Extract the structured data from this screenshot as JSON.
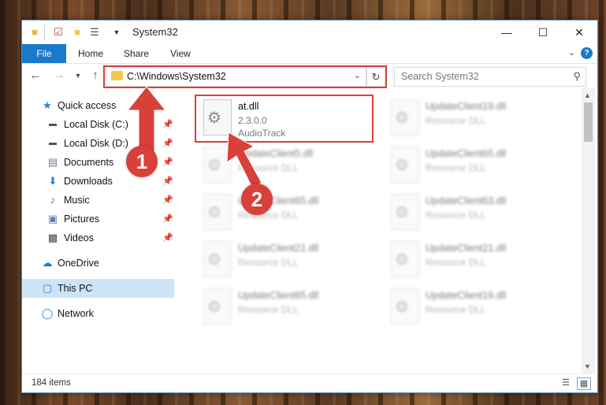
{
  "window": {
    "title": "System32",
    "minimize_glyph": "—",
    "maximize_glyph": "☐",
    "close_glyph": "✕"
  },
  "ribbon": {
    "file_label": "File",
    "tabs": [
      "Home",
      "Share",
      "View"
    ]
  },
  "address": {
    "path": "C:\\Windows\\System32"
  },
  "search": {
    "placeholder": "Search System32"
  },
  "sidebar": {
    "items": [
      {
        "label": "Quick access",
        "icon": "star-icon"
      },
      {
        "label": "Local Disk (C:)",
        "icon": "drive-icon"
      },
      {
        "label": "Local Disk (D:)",
        "icon": "drive-icon"
      },
      {
        "label": "Documents",
        "icon": "documents-icon"
      },
      {
        "label": "Downloads",
        "icon": "download-icon"
      },
      {
        "label": "Music",
        "icon": "music-icon"
      },
      {
        "label": "Pictures",
        "icon": "pictures-icon"
      },
      {
        "label": "Videos",
        "icon": "videos-icon"
      },
      {
        "label": "OneDrive",
        "icon": "cloud-icon"
      },
      {
        "label": "This PC",
        "icon": "computer-icon"
      },
      {
        "label": "Network",
        "icon": "network-icon"
      }
    ]
  },
  "files": {
    "highlighted": {
      "name": "at.dll",
      "version": "2.3.0.0",
      "description": "AudioTrack"
    },
    "others": [
      {
        "name": "UpdateClient19.dll",
        "type": "Resource DLL"
      },
      {
        "name": "UpdateClient5.dll",
        "type": "Resource DLL"
      },
      {
        "name": "UpdateClient65.dll",
        "type": "Resource DLL"
      },
      {
        "name": "UpdateClient65.dll",
        "type": "Resource DLL"
      },
      {
        "name": "UpdateClient63.dll",
        "type": "Resource DLL"
      },
      {
        "name": "UpdateClient21.dll",
        "type": "Resource DLL"
      },
      {
        "name": "UpdateClient21.dll",
        "type": "Resource DLL"
      },
      {
        "name": "UpdateClient65.dll",
        "type": "Resource DLL"
      },
      {
        "name": "UpdateClient19.dll",
        "type": "Resource DLL"
      }
    ]
  },
  "status": {
    "item_count": "184 items"
  },
  "annotations": {
    "step1": "1",
    "step2": "2",
    "color": "#d9403a"
  }
}
